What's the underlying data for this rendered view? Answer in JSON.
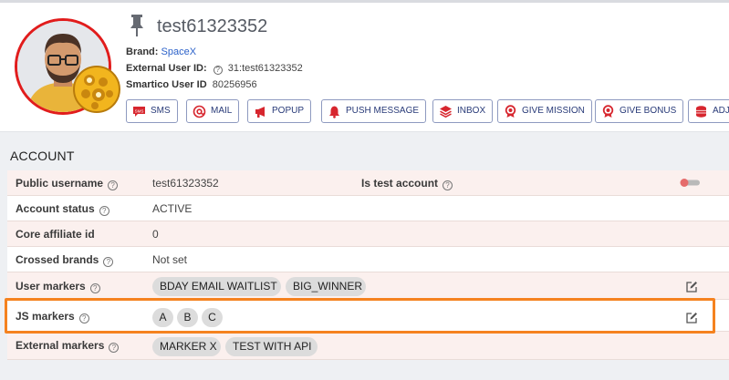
{
  "profile": {
    "username": "test61323352",
    "brand_label": "Brand:",
    "brand_value": "SpaceX",
    "external_id_label": "External User ID:",
    "external_id_value": "31:test61323352",
    "smartico_id_label": "Smartico User ID",
    "smartico_id_value": "80256956"
  },
  "actions": [
    {
      "label": "SMS",
      "icon": "sms-icon"
    },
    {
      "label": "MAIL",
      "icon": "at-icon"
    },
    {
      "label": "POPUP",
      "icon": "megaphone-icon"
    },
    {
      "label": "PUSH MESSAGE",
      "icon": "bell-icon"
    },
    {
      "label": "INBOX",
      "icon": "layers-icon"
    },
    {
      "label": "GIVE MISSION",
      "icon": "award-icon"
    },
    {
      "label": "GIVE BONUS",
      "icon": "award-icon"
    },
    {
      "label": "ADJ",
      "icon": "coins-icon"
    }
  ],
  "account": {
    "title": "ACCOUNT",
    "public_username_label": "Public username",
    "public_username_value": "test61323352",
    "is_test_label": "Is test account",
    "is_test_value": false,
    "status_label": "Account status",
    "status_value": "ACTIVE",
    "affiliate_label": "Core affiliate id",
    "affiliate_value": "0",
    "crossed_label": "Crossed brands",
    "crossed_value": "Not set",
    "user_markers_label": "User markers",
    "user_markers": [
      "BDAY EMAIL WAITLIST",
      "BIG_WINNER"
    ],
    "js_markers_label": "JS markers",
    "js_markers": [
      "A",
      "B",
      "C"
    ],
    "external_markers_label": "External markers",
    "external_markers": [
      "MARKER X",
      "TEST WITH API"
    ]
  },
  "colors": {
    "accent_button_text": "#283a78",
    "row_pink": "#fbf0ee",
    "highlight": "#f5821f",
    "avatar_ring": "#e11c1c"
  }
}
